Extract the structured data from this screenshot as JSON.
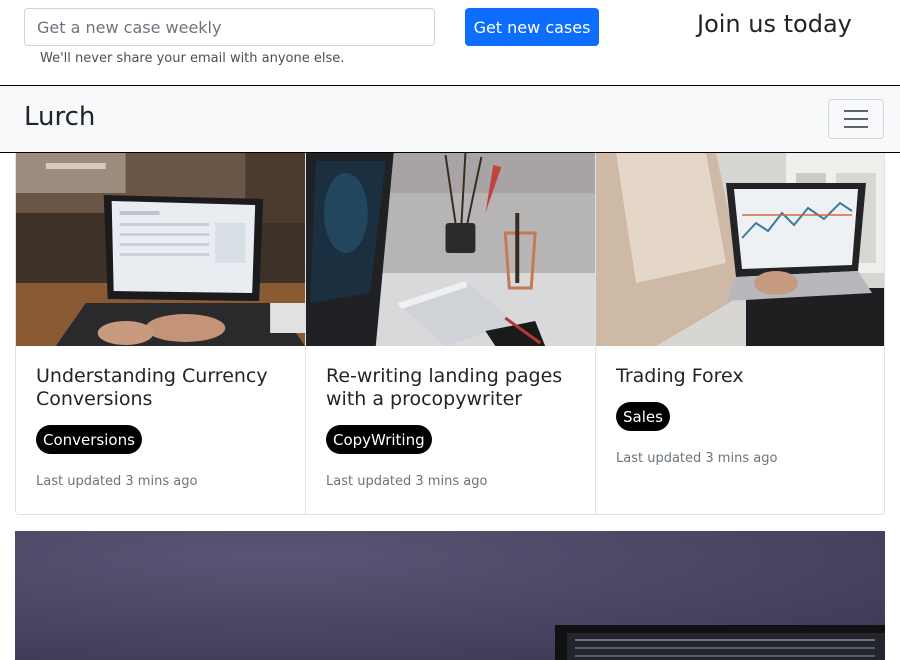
{
  "subscribe": {
    "email_placeholder": "Get a new case weekly",
    "email_help": "We'll never share your email with anyone else.",
    "submit_label": "Get new cases",
    "join_heading": "Join us today"
  },
  "navbar": {
    "brand": "Lurch",
    "toggler_icon": "hamburger-menu-icon"
  },
  "cards": [
    {
      "image": "laptop-dashboard-photo",
      "title": "Understanding Currency Conversions",
      "badge": "Conversions",
      "updated": "Last updated 3 mins ago"
    },
    {
      "image": "desk-laptop-notebook-photo",
      "title": "Re-writing landing pages with a procopywriter",
      "badge": "CopyWriting",
      "updated": "Last updated 3 mins ago"
    },
    {
      "image": "laptop-trading-chart-photo",
      "title": "Trading Forex",
      "badge": "Sales",
      "updated": "Last updated 3 mins ago"
    }
  ],
  "hero": {
    "image": "purple-wall-laptop-photo"
  },
  "colors": {
    "primary": "#0d6efd",
    "navbar_bg": "#f8f9fa",
    "badge_bg": "#000000",
    "muted_text": "#6c757d"
  }
}
